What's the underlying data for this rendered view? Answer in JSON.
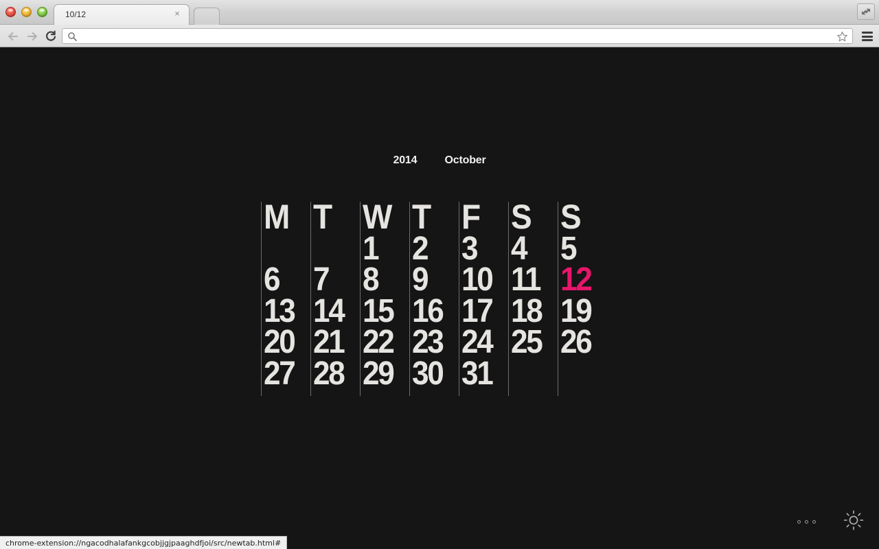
{
  "window": {
    "tab_title": "10/12",
    "tab_close_label": "×",
    "maximize_label": "maximize"
  },
  "toolbar": {
    "back_label": "Back",
    "forward_label": "Forward",
    "reload_label": "Reload",
    "omnibox_value": "",
    "omnibox_placeholder": "",
    "bookmark_label": "Bookmark this page",
    "menu_label": "Customize and control"
  },
  "status_bar": {
    "url": "chrome-extension://ngacodhalafankgcobjjgjpaaghdfjoi/src/newtab.html#"
  },
  "calendar": {
    "year": "2014",
    "month": "October",
    "accent_color": "#e8156b",
    "text_color": "#e6e4e1",
    "background_color": "#151515",
    "grid_line_color": "#6d6d6d",
    "columns": [
      {
        "dow": "M",
        "days": [
          "",
          "6",
          "13",
          "20",
          "27"
        ]
      },
      {
        "dow": "T",
        "days": [
          "",
          "7",
          "14",
          "21",
          "28"
        ]
      },
      {
        "dow": "W",
        "days": [
          "1",
          "8",
          "15",
          "22",
          "29"
        ]
      },
      {
        "dow": "T",
        "days": [
          "2",
          "9",
          "16",
          "23",
          "30"
        ]
      },
      {
        "dow": "F",
        "days": [
          "3",
          "10",
          "17",
          "24",
          "31"
        ]
      },
      {
        "dow": "S",
        "days": [
          "4",
          "11",
          "18",
          "25",
          ""
        ]
      },
      {
        "dow": "S",
        "days": [
          "5",
          "12",
          "19",
          "26",
          ""
        ]
      }
    ],
    "today": "12",
    "today_column": 6,
    "today_row": 1
  },
  "footer": {
    "options_label": "options-dots",
    "theme_label": "brightness-sun"
  }
}
